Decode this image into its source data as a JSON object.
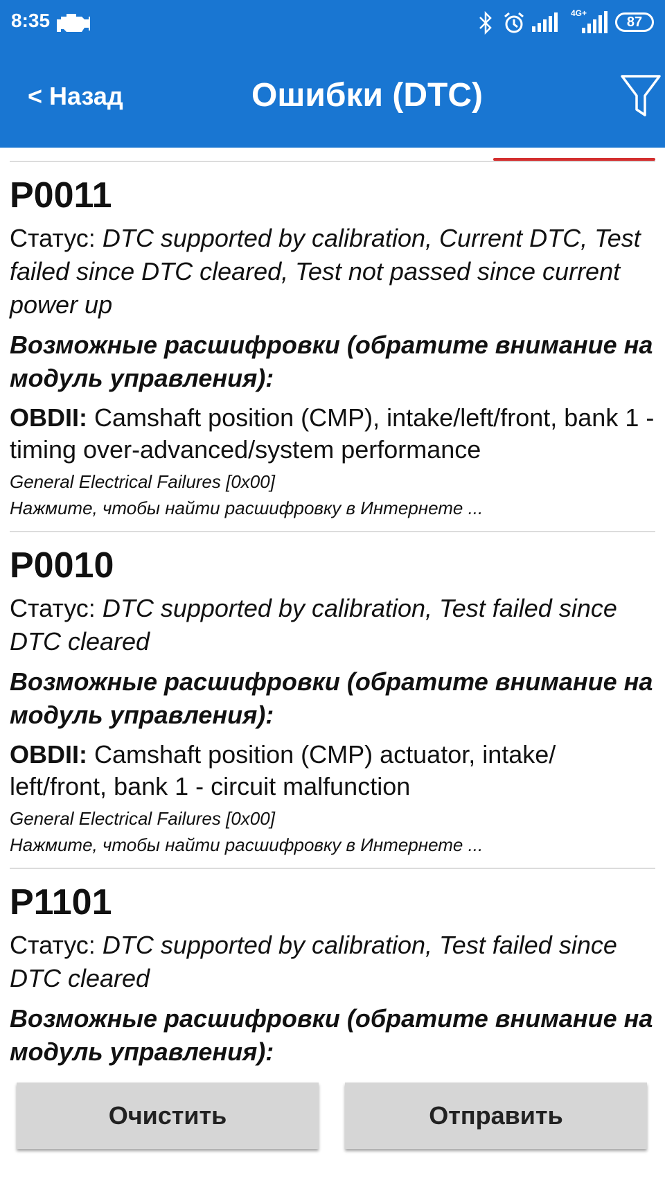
{
  "statusbar": {
    "time": "8:35",
    "network": "4G+",
    "battery": "87"
  },
  "appbar": {
    "back_label": "< Назад",
    "title": "Ошибки (DTC)"
  },
  "dtc_items": [
    {
      "code": "P0011",
      "status_label": "Статус:",
      "status_value": "DTC supported by calibration, Current DTC, Test failed since DTC cleared, Test not passed since current power up",
      "decode_heading": "Возможные расшифровки (обратите внимание на модуль управления):",
      "obd_label": "OBDII:",
      "obd_text": "Camshaft position (CMP), intake/left/front, bank 1 - timing over-advanced/system performance",
      "category": "General Electrical Failures [0x00]",
      "search_hint": "Нажмите, чтобы найти расшифровку в Интернете ..."
    },
    {
      "code": "P0010",
      "status_label": "Статус:",
      "status_value": "DTC supported by calibration, Test failed since DTC cleared",
      "decode_heading": "Возможные расшифровки (обратите внимание на модуль управления):",
      "obd_label": "OBDII:",
      "obd_text": "Camshaft position (CMP) actuator, intake/ left/front, bank 1 - circuit malfunction",
      "category": "General Electrical Failures [0x00]",
      "search_hint": "Нажмите, чтобы найти расшифровку в Интернете ..."
    },
    {
      "code": "P1101",
      "status_label": "Статус:",
      "status_value": "DTC supported by calibration, Test failed since DTC cleared",
      "decode_heading": "Возможные расшифровки (обратите внимание на модуль управления):"
    }
  ],
  "buttons": {
    "clear_label": "Очистить",
    "send_label": "Отправить"
  },
  "colors": {
    "appbar": "#1976d2",
    "button_bg": "#d6d6d6",
    "accent_line": "#d32f2f"
  },
  "icons": [
    "engine-icon",
    "bluetooth-icon",
    "alarm-icon",
    "signal-icon",
    "filter-icon"
  ]
}
